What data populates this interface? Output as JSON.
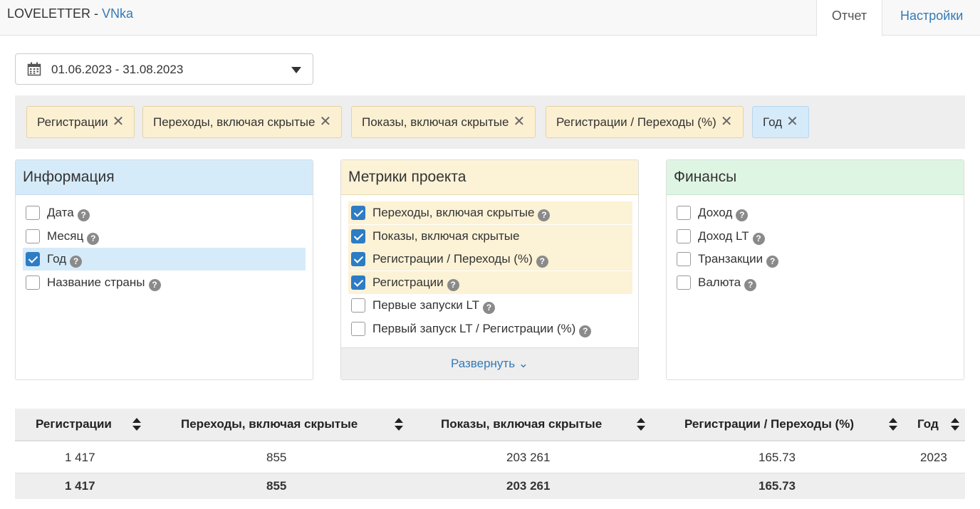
{
  "header": {
    "brand": "LOVELETTER",
    "separator": " - ",
    "project": "VNka",
    "tab_report": "Отчет",
    "tab_settings": "Настройки"
  },
  "date_range": {
    "value": "01.06.2023 - 31.08.2023"
  },
  "chips": [
    {
      "label": "Регистрации",
      "close": "✕"
    },
    {
      "label": "Переходы, включая скрытые",
      "close": "✕"
    },
    {
      "label": "Показы, включая скрытые",
      "close": "✕"
    },
    {
      "label": "Регистрации / Переходы (%)",
      "close": "✕"
    },
    {
      "label": "Год",
      "close": "✕"
    }
  ],
  "panels": {
    "info": {
      "title": "Информация",
      "items": [
        {
          "label": "Дата",
          "checked": false,
          "help": "?"
        },
        {
          "label": "Месяц",
          "checked": false,
          "help": "?"
        },
        {
          "label": "Год",
          "checked": true,
          "help": "?"
        },
        {
          "label": "Название страны",
          "checked": false,
          "help": "?"
        }
      ]
    },
    "metrics": {
      "title": "Метрики проекта",
      "items": [
        {
          "label": "Переходы, включая скрытые",
          "checked": true,
          "help": "?"
        },
        {
          "label": "Показы, включая скрытые",
          "checked": true,
          "help": ""
        },
        {
          "label": "Регистрации / Переходы (%)",
          "checked": true,
          "help": "?"
        },
        {
          "label": "Регистрации",
          "checked": true,
          "help": "?"
        },
        {
          "label": "Первые запуски LT",
          "checked": false,
          "help": "?"
        },
        {
          "label": "Первый запуск LT / Регистрации (%)",
          "checked": false,
          "help": "?"
        }
      ],
      "expand_label": "Развернуть ⌄"
    },
    "finance": {
      "title": "Финансы",
      "items": [
        {
          "label": "Доход",
          "checked": false,
          "help": "?"
        },
        {
          "label": "Доход LT",
          "checked": false,
          "help": "?"
        },
        {
          "label": "Транзакции",
          "checked": false,
          "help": "?"
        },
        {
          "label": "Валюта",
          "checked": false,
          "help": "?"
        }
      ]
    }
  },
  "table": {
    "columns": [
      "Регистрации",
      "Переходы, включая скрытые",
      "Показы, включая скрытые",
      "Регистрации / Переходы (%)",
      "Год"
    ],
    "rows": [
      [
        "1 417",
        "855",
        "203 261",
        "165.73",
        "2023"
      ]
    ],
    "total": [
      "1 417",
      "855",
      "203 261",
      "165.73",
      ""
    ]
  },
  "colors": {
    "link": "#337ab7",
    "checkbox_on": "#2d7cc4",
    "info_header": "#d6ebfa",
    "metrics_header": "#fcf2d6",
    "finance_header": "#dff5e3"
  }
}
